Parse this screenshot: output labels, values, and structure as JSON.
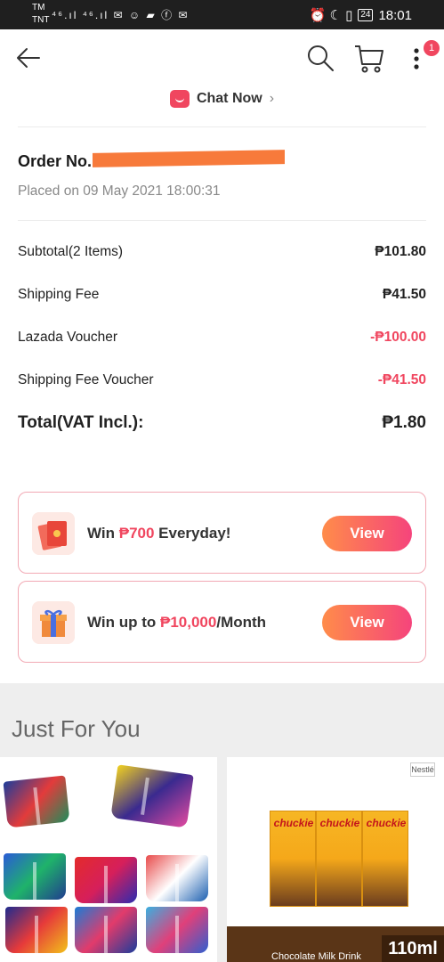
{
  "status_bar": {
    "carrier_top": "TM",
    "carrier_bottom": "TNT",
    "left_icons": "⁴⁶.ıl ⁴⁶.ıl ✉ ☺ ▰ ⓕ ✉",
    "right_icons": "⏰ ☾ ▯",
    "battery": "24",
    "time": "18:01"
  },
  "header": {
    "cart_badge": "1",
    "chat_label": "Chat Now"
  },
  "order": {
    "order_no_label": "Order No.",
    "placed_on": "Placed on 09 May 2021  18:00:31"
  },
  "summary": {
    "subtotal_label": "Subtotal(2 Items)",
    "subtotal_value": "₱101.80",
    "shipping_label": "Shipping Fee",
    "shipping_value": "₱41.50",
    "voucher_label": "Lazada Voucher",
    "voucher_value": "-₱100.00",
    "ship_voucher_label": "Shipping Fee Voucher",
    "ship_voucher_value": "-₱41.50",
    "total_label": "Total(VAT Incl.):",
    "total_value": "₱1.80"
  },
  "promos": [
    {
      "prefix": "Win ",
      "highlight": "₱700",
      "suffix": " Everyday!",
      "button": "View"
    },
    {
      "prefix": "Win up to ",
      "highlight": "₱10,000",
      "suffix": "/Month",
      "button": "View"
    }
  ],
  "just_for_you": {
    "title": "Just For You",
    "product_right": {
      "brand_badge": "Nestlé",
      "box_label": "chuckie",
      "volume": "110ml",
      "caption": "Chocolate Milk Drink"
    }
  },
  "colors": {
    "accent": "#f0465f",
    "button_gradient_start": "#ff8c4a",
    "button_gradient_end": "#f5447c",
    "redaction": "#f77a3b"
  }
}
